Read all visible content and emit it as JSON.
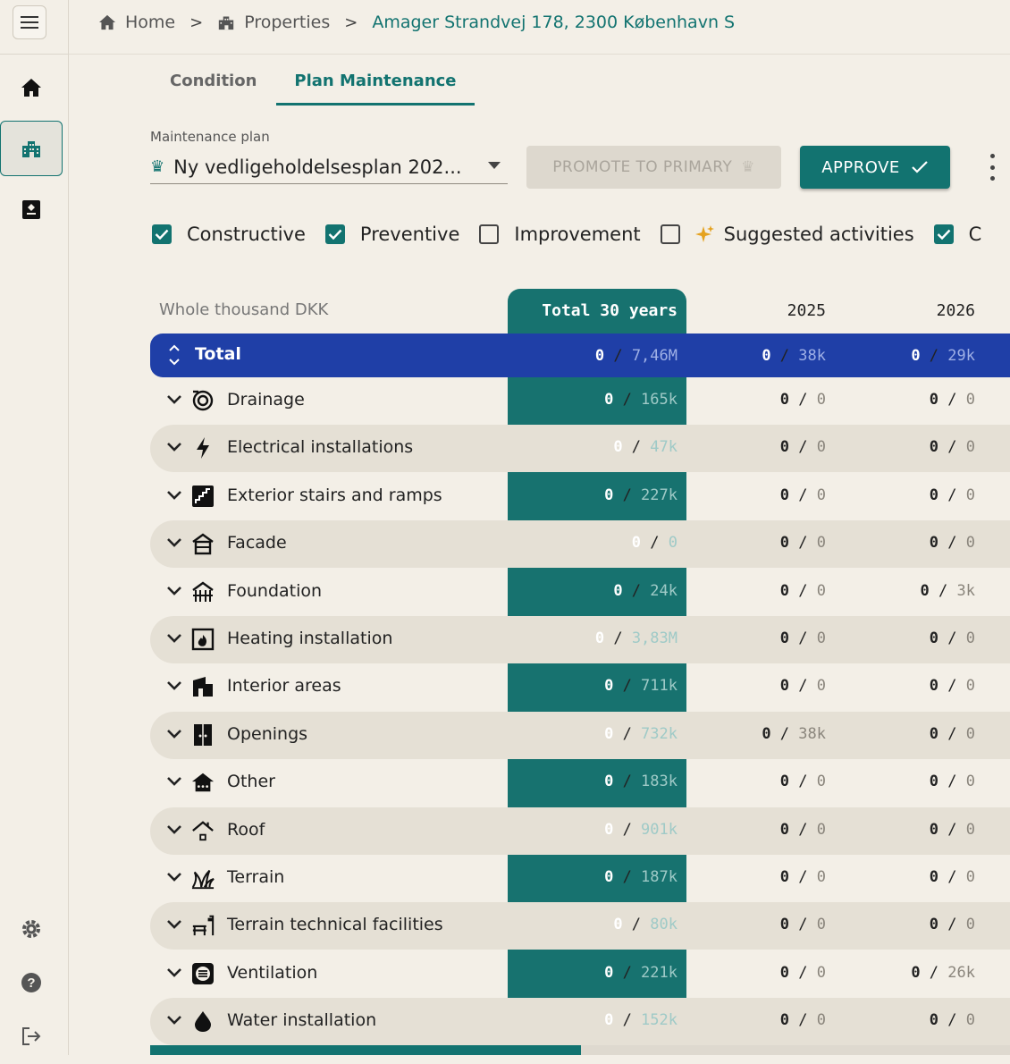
{
  "breadcrumb": {
    "home": "Home",
    "properties": "Properties",
    "address": "Amager Strandvej 178, 2300 København S"
  },
  "tabs": [
    {
      "label": "Condition"
    },
    {
      "label": "Plan Maintenance"
    }
  ],
  "plan": {
    "label": "Maintenance plan",
    "value": "Ny vedligeholdelsesplan 202..."
  },
  "buttons": {
    "promote": "PROMOTE TO PRIMARY",
    "approve": "APPROVE"
  },
  "filters": [
    {
      "label": "Constructive",
      "checked": true
    },
    {
      "label": "Preventive",
      "checked": true
    },
    {
      "label": "Improvement",
      "checked": false
    },
    {
      "label": "Suggested activities",
      "checked": false
    },
    {
      "label": "C",
      "checked": true
    }
  ],
  "table": {
    "unit_label": "Whole thousand DKK",
    "columns": {
      "total": "Total 30 years",
      "y1": "2025",
      "y2": "2026"
    },
    "total": {
      "label": "Total",
      "t_a": "0",
      "t_b": "7,46M",
      "c1_a": "0",
      "c1_b": "38k",
      "c2_a": "0",
      "c2_b": "29k"
    },
    "rows": [
      {
        "label": "Drainage",
        "icon": "drainage-icon",
        "t_a": "0",
        "t_b": "165k",
        "c1_a": "0",
        "c1_b": "0",
        "c2_a": "0",
        "c2_b": "0"
      },
      {
        "label": "Electrical installations",
        "icon": "lightning-icon",
        "t_a": "0",
        "t_b": "47k",
        "c1_a": "0",
        "c1_b": "0",
        "c2_a": "0",
        "c2_b": "0"
      },
      {
        "label": "Exterior stairs and ramps",
        "icon": "stairs-icon",
        "t_a": "0",
        "t_b": "227k",
        "c1_a": "0",
        "c1_b": "0",
        "c2_a": "0",
        "c2_b": "0"
      },
      {
        "label": "Facade",
        "icon": "facade-icon",
        "t_a": "0",
        "t_b": "0",
        "c1_a": "0",
        "c1_b": "0",
        "c2_a": "0",
        "c2_b": "0"
      },
      {
        "label": "Foundation",
        "icon": "foundation-icon",
        "t_a": "0",
        "t_b": "24k",
        "c1_a": "0",
        "c1_b": "0",
        "c2_a": "0",
        "c2_b": "3k"
      },
      {
        "label": "Heating installation",
        "icon": "heating-icon",
        "t_a": "0",
        "t_b": "3,83M",
        "c1_a": "0",
        "c1_b": "0",
        "c2_a": "0",
        "c2_b": "0"
      },
      {
        "label": "Interior areas",
        "icon": "interior-icon",
        "t_a": "0",
        "t_b": "711k",
        "c1_a": "0",
        "c1_b": "0",
        "c2_a": "0",
        "c2_b": "0"
      },
      {
        "label": "Openings",
        "icon": "door-icon",
        "t_a": "0",
        "t_b": "732k",
        "c1_a": "0",
        "c1_b": "38k",
        "c2_a": "0",
        "c2_b": "0"
      },
      {
        "label": "Other",
        "icon": "other-house-icon",
        "t_a": "0",
        "t_b": "183k",
        "c1_a": "0",
        "c1_b": "0",
        "c2_a": "0",
        "c2_b": "0"
      },
      {
        "label": "Roof",
        "icon": "roof-icon",
        "t_a": "0",
        "t_b": "901k",
        "c1_a": "0",
        "c1_b": "0",
        "c2_a": "0",
        "c2_b": "0"
      },
      {
        "label": "Terrain",
        "icon": "grass-icon",
        "t_a": "0",
        "t_b": "187k",
        "c1_a": "0",
        "c1_b": "0",
        "c2_a": "0",
        "c2_b": "0"
      },
      {
        "label": "Terrain technical facilities",
        "icon": "bench-icon",
        "t_a": "0",
        "t_b": "80k",
        "c1_a": "0",
        "c1_b": "0",
        "c2_a": "0",
        "c2_b": "0"
      },
      {
        "label": "Ventilation",
        "icon": "ventilation-icon",
        "t_a": "0",
        "t_b": "221k",
        "c1_a": "0",
        "c1_b": "0",
        "c2_a": "0",
        "c2_b": "26k"
      },
      {
        "label": "Water installation",
        "icon": "water-drop-icon",
        "t_a": "0",
        "t_b": "152k",
        "c1_a": "0",
        "c1_b": "0",
        "c2_a": "0",
        "c2_b": "0"
      }
    ]
  },
  "colors": {
    "accent": "#127370",
    "total_row": "#1f3fa7",
    "background": "#f3efe7"
  }
}
